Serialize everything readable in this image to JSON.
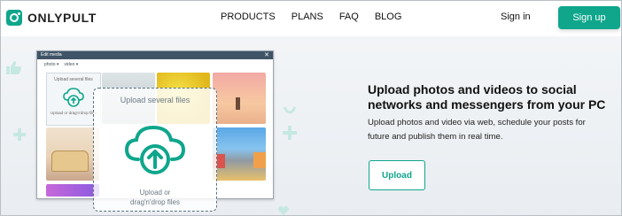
{
  "brand": {
    "name": "ONLYPULT"
  },
  "nav": {
    "items": [
      {
        "label": "PRODUCTS"
      },
      {
        "label": "PLANS"
      },
      {
        "label": "FAQ"
      },
      {
        "label": "BLOG"
      }
    ]
  },
  "auth": {
    "signin_label": "Sign in",
    "signup_label": "Sign up"
  },
  "modal": {
    "title": "Edit media",
    "close_glyph": "✕",
    "tabs": [
      {
        "label": "photo ▾"
      },
      {
        "label": "video ▾"
      }
    ],
    "mini_upload_title": "Upload several files",
    "mini_upload_subtitle": "Upload or drag'n'drop files"
  },
  "dropzone": {
    "title": "Upload several files",
    "subtitle_line1": "Upload or",
    "subtitle_line2": "drag'n'drop files"
  },
  "hero": {
    "headline": "Upload photos and videos to social networks and messengers from your PC",
    "description": "Upload photos and video via web, schedule your posts for future and publish them in real time.",
    "cta_label": "Upload"
  },
  "colors": {
    "accent": "#0fa68c",
    "modal_bar": "#3f5466"
  },
  "icons": {
    "logo": "camera-logo-icon",
    "cloud_upload": "cloud-upload-icon",
    "close": "close-icon"
  }
}
